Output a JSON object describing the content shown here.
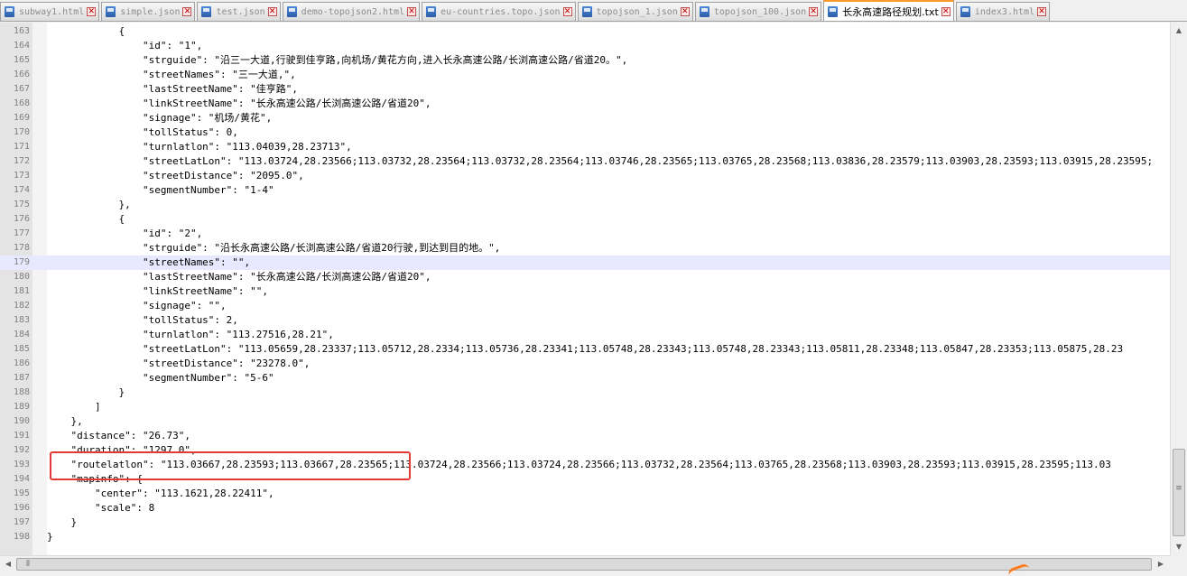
{
  "tabs": [
    {
      "label": "subway1.html",
      "active": false
    },
    {
      "label": "simple.json",
      "active": false
    },
    {
      "label": "test.json",
      "active": false
    },
    {
      "label": "demo-topojson2.html",
      "active": false
    },
    {
      "label": "eu-countries.topo.json",
      "active": false
    },
    {
      "label": "topojson_1.json",
      "active": false
    },
    {
      "label": "topojson_100.json",
      "active": false
    },
    {
      "label": "长永高速路径规划.txt",
      "active": true
    },
    {
      "label": "index3.html",
      "active": false
    }
  ],
  "editor": {
    "highlighted_line": 179,
    "lines": [
      {
        "num": "163",
        "text": "            {"
      },
      {
        "num": "164",
        "text": "                \"id\": \"1\","
      },
      {
        "num": "165",
        "text": "                \"strguide\": \"沿三一大道,行驶到佳亨路,向机场/黄花方向,进入长永高速公路/长浏高速公路/省道20。\","
      },
      {
        "num": "166",
        "text": "                \"streetNames\": \"三一大道,\","
      },
      {
        "num": "167",
        "text": "                \"lastStreetName\": \"佳亨路\","
      },
      {
        "num": "168",
        "text": "                \"linkStreetName\": \"长永高速公路/长浏高速公路/省道20\","
      },
      {
        "num": "169",
        "text": "                \"signage\": \"机场/黄花\","
      },
      {
        "num": "170",
        "text": "                \"tollStatus\": 0,"
      },
      {
        "num": "171",
        "text": "                \"turnlatlon\": \"113.04039,28.23713\","
      },
      {
        "num": "172",
        "text": "                \"streetLatLon\": \"113.03724,28.23566;113.03732,28.23564;113.03732,28.23564;113.03746,28.23565;113.03765,28.23568;113.03836,28.23579;113.03903,28.23593;113.03915,28.23595;"
      },
      {
        "num": "173",
        "text": "                \"streetDistance\": \"2095.0\","
      },
      {
        "num": "174",
        "text": "                \"segmentNumber\": \"1-4\""
      },
      {
        "num": "175",
        "text": "            },"
      },
      {
        "num": "176",
        "text": "            {"
      },
      {
        "num": "177",
        "text": "                \"id\": \"2\","
      },
      {
        "num": "178",
        "text": "                \"strguide\": \"沿长永高速公路/长浏高速公路/省道20行驶,到达到目的地。\","
      },
      {
        "num": "179",
        "text": "                \"streetNames\": \"\","
      },
      {
        "num": "180",
        "text": "                \"lastStreetName\": \"长永高速公路/长浏高速公路/省道20\","
      },
      {
        "num": "181",
        "text": "                \"linkStreetName\": \"\","
      },
      {
        "num": "182",
        "text": "                \"signage\": \"\","
      },
      {
        "num": "183",
        "text": "                \"tollStatus\": 2,"
      },
      {
        "num": "184",
        "text": "                \"turnlatlon\": \"113.27516,28.21\","
      },
      {
        "num": "185",
        "text": "                \"streetLatLon\": \"113.05659,28.23337;113.05712,28.2334;113.05736,28.23341;113.05748,28.23343;113.05748,28.23343;113.05811,28.23348;113.05847,28.23353;113.05875,28.23"
      },
      {
        "num": "186",
        "text": "                \"streetDistance\": \"23278.0\","
      },
      {
        "num": "187",
        "text": "                \"segmentNumber\": \"5-6\""
      },
      {
        "num": "188",
        "text": "            }"
      },
      {
        "num": "189",
        "text": "        ]"
      },
      {
        "num": "190",
        "text": "    },"
      },
      {
        "num": "191",
        "text": "    \"distance\": \"26.73\","
      },
      {
        "num": "192",
        "text": "    \"duration\": \"1297.0\","
      },
      {
        "num": "193",
        "text": "    \"routelatlon\": \"113.03667,28.23593;113.03667,28.23565;113.03724,28.23566;113.03724,28.23566;113.03732,28.23564;113.03765,28.23568;113.03903,28.23593;113.03915,28.23595;113.03"
      },
      {
        "num": "194",
        "text": "    \"mapinfo\": {"
      },
      {
        "num": "195",
        "text": "        \"center\": \"113.1621,28.22411\","
      },
      {
        "num": "196",
        "text": "        \"scale\": 8"
      },
      {
        "num": "197",
        "text": "    }"
      },
      {
        "num": "198",
        "text": "}"
      }
    ]
  },
  "icons": {
    "scroll_up": "▲",
    "scroll_down": "▼",
    "scroll_left": "◀",
    "scroll_right": "▶",
    "tab_close": "✕"
  },
  "colors": {
    "active_tab_accent": "#fa9a2a",
    "highlight_line": "#e8e8ff",
    "annotation_box": "#e53935"
  }
}
